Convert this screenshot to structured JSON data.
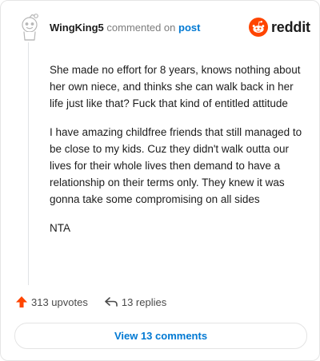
{
  "comment": {
    "username": "WingKing5",
    "action_text": "commented on",
    "post_link_label": "post",
    "paragraphs": [
      "She made no effort for 8 years, knows nothing about her own niece, and thinks she can walk back in her life just like that? Fuck that kind of entitled attitude",
      "I have amazing childfree friends that still managed to be close to my kids. Cuz they didn't walk outta our lives for their whole lives then demand to have a relationship on their terms only. They knew it was gonna take some compromising on all sides",
      "NTA"
    ]
  },
  "brand": {
    "name": "reddit",
    "icon": "reddit-snoo-icon",
    "accent": "#ff4500"
  },
  "actions": {
    "upvotes_label": "313 upvotes",
    "upvote_icon": "upvote-arrow-icon",
    "replies_label": "13 replies",
    "reply_icon": "reply-arrow-icon"
  },
  "view_comments_label": "View 13 comments",
  "colors": {
    "link": "#0079d3",
    "upvote": "#ff4500",
    "muted": "#7c7c7c"
  }
}
